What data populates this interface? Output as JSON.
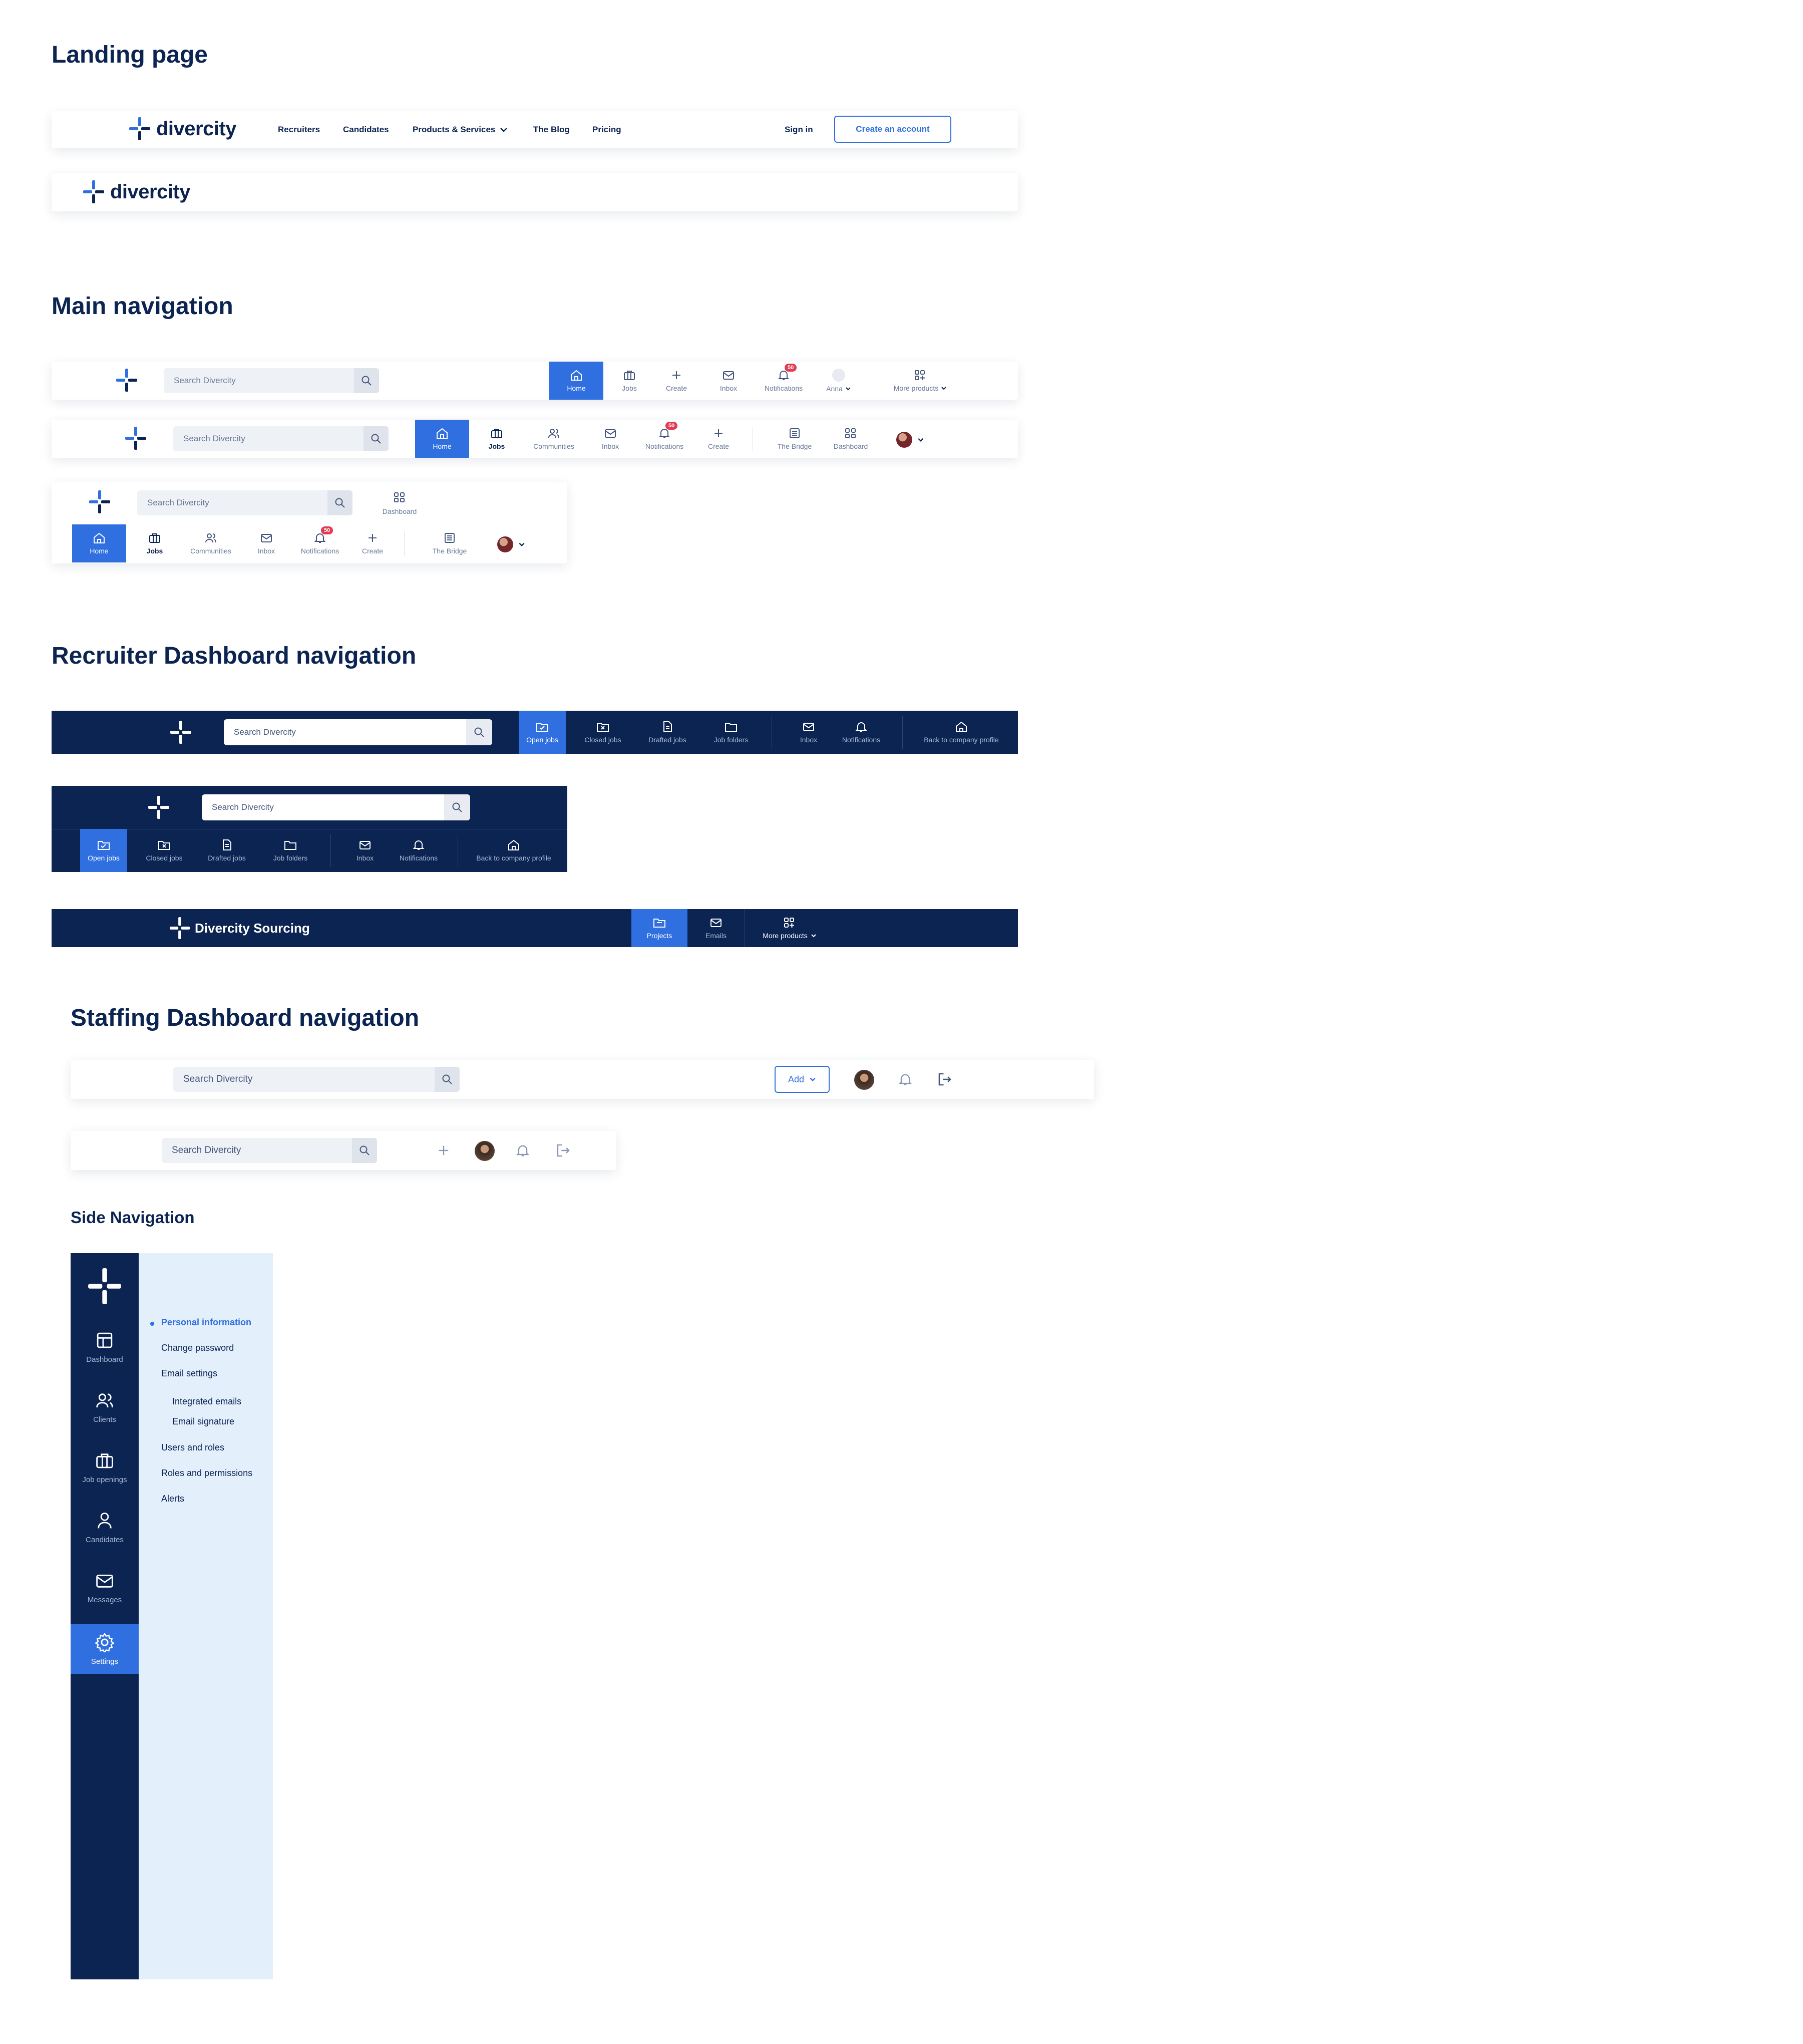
{
  "sections": {
    "landing": "Landing page",
    "main_nav": "Main navigation",
    "recruiter": "Recruiter Dashboard navigation",
    "staffing": "Staffing  Dashboard navigation",
    "side": "Side Navigation"
  },
  "brand": {
    "name": "divercity",
    "sourcing": "Divercity Sourcing"
  },
  "landing": {
    "links": [
      "Recruiters",
      "Candidates",
      "Products & Services",
      "The Blog",
      "Pricing"
    ],
    "sign_in": "Sign in",
    "create_account": "Create an account"
  },
  "search_placeholder": "Search Divercity",
  "nav1": {
    "items": [
      "Home",
      "Jobs",
      "Create",
      "Inbox",
      "Notifications",
      "Anna",
      "More products"
    ],
    "badge": "50"
  },
  "nav2": {
    "items": [
      "Home",
      "Jobs",
      "Communities",
      "Inbox",
      "Notifications",
      "Create",
      "The Bridge",
      "Dashboard"
    ],
    "badge": "50"
  },
  "nav3": {
    "dashboard": "Dashboard",
    "items": [
      "Home",
      "Jobs",
      "Communities",
      "Inbox",
      "Notifications",
      "Create",
      "The Bridge"
    ],
    "badge": "50"
  },
  "recruiter": {
    "items": [
      "Open jobs",
      "Closed jobs",
      "Drafted jobs",
      "Job folders",
      "Inbox",
      "Notifications",
      "Back to company profile"
    ]
  },
  "sourcing": {
    "items": [
      "Projects",
      "Emails",
      "More products"
    ]
  },
  "staffing": {
    "add": "Add"
  },
  "side_nav": {
    "items": [
      "Dashboard",
      "Clients",
      "Job openings",
      "Candidates",
      "Messages",
      "Settings"
    ],
    "active": "Settings",
    "sub": [
      "Personal information",
      "Change password",
      "Email settings",
      "Integrated emails",
      "Email signature",
      "Users and roles",
      "Roles and permissions",
      "Alerts"
    ]
  },
  "colors": {
    "navy": "#0b2452",
    "accent": "#2f6fe0",
    "badge": "#e23b52",
    "side_sub_bg": "#e4effc"
  }
}
